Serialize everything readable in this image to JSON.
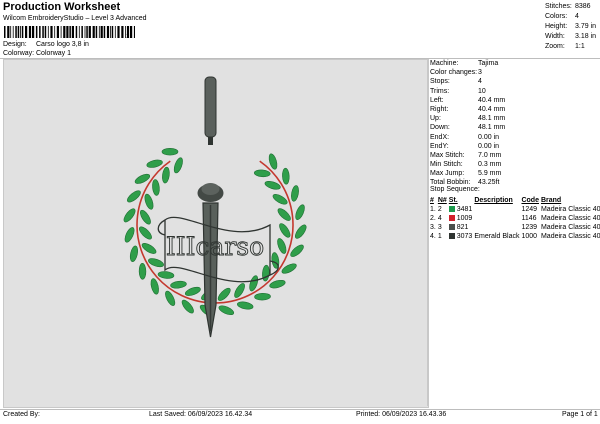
{
  "header": {
    "title": "Production Worksheet",
    "software": "Wilcom EmbroideryStudio – Level 3 Advanced",
    "barcode_number": "1",
    "design_label": "Design:",
    "design_value": "Carso logo 3,8 in",
    "colorway_label": "Colorway:",
    "colorway_value": "Colorway 1"
  },
  "stats": [
    {
      "label": "Stitches:",
      "value": "8386"
    },
    {
      "label": "Colors:",
      "value": "4"
    },
    {
      "label": "Height:",
      "value": "3.79 in"
    },
    {
      "label": "Width:",
      "value": "3.18 in"
    },
    {
      "label": "Zoom:",
      "value": "1:1"
    }
  ],
  "params": [
    {
      "label": "Machine:",
      "value": "Tajima"
    },
    {
      "label": "Color changes:",
      "value": "3"
    },
    {
      "label": "Stops:",
      "value": "4"
    },
    {
      "label": "Trims:",
      "value": "10"
    },
    {
      "label": "Left:",
      "value": "40.4 mm"
    },
    {
      "label": "Right:",
      "value": "40.4 mm"
    },
    {
      "label": "Up:",
      "value": "48.1 mm"
    },
    {
      "label": "Down:",
      "value": "48.1 mm"
    },
    {
      "label": "EndX:",
      "value": "0.00 in"
    },
    {
      "label": "EndY:",
      "value": "0.00 in"
    },
    {
      "label": "Max Stitch:",
      "value": "7.0 mm"
    },
    {
      "label": "Min Stitch:",
      "value": "0.3 mm"
    },
    {
      "label": "Max Jump:",
      "value": "5.9 mm"
    },
    {
      "label": "Total Bobbin:",
      "value": "43.25ft"
    }
  ],
  "stop_sequence": {
    "title": "Stop Sequence:",
    "headers": [
      "#",
      "N#",
      "St.",
      "Description",
      "Code",
      "Brand"
    ],
    "rows": [
      {
        "num": "1.",
        "needle": "2",
        "color": "#1e9a4e",
        "st": "3481",
        "desc": "",
        "code": "1249",
        "brand": "Madeira Classic 40"
      },
      {
        "num": "2.",
        "needle": "4",
        "color": "#d3202b",
        "st": "1009",
        "desc": "",
        "code": "1146",
        "brand": "Madeira Classic 40"
      },
      {
        "num": "3.",
        "needle": "3",
        "color": "#4a4f4c",
        "st": "821",
        "desc": "",
        "code": "1239",
        "brand": "Madeira Classic 40"
      },
      {
        "num": "4.",
        "needle": "1",
        "color": "#2f3431",
        "st": "3073",
        "desc": "Emerald Black",
        "code": "1000",
        "brand": "Madeira Classic 40"
      }
    ]
  },
  "design": {
    "text": "IIIcarso",
    "leaf_color": "#2f9e4a",
    "ring_color": "#c4382f",
    "sword_color": "#3f4541"
  },
  "footer": {
    "created_by": "Created By:",
    "last_saved": "Last Saved: 06/09/2023 16.42.34",
    "printed": "Printed: 06/09/2023 16.43.36",
    "page": "Page 1 of 1"
  }
}
